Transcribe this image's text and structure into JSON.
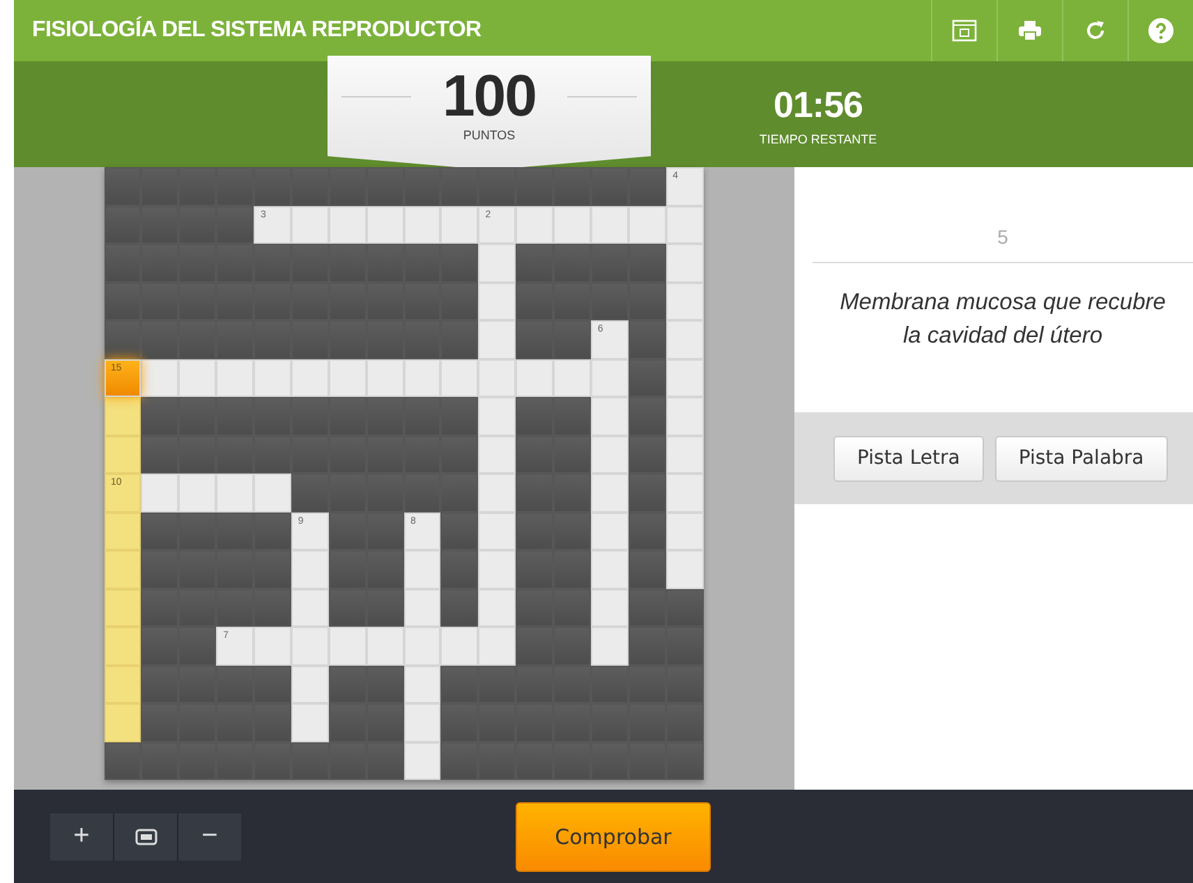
{
  "title": "FISIOLOGÍA DEL SISTEMA REPRODUCTOR",
  "toolbar": [
    {
      "kind": "fullscreen"
    },
    {
      "kind": "print"
    },
    {
      "kind": "restart"
    },
    {
      "kind": "help"
    }
  ],
  "score": {
    "value": "100",
    "label": "PUNTOS"
  },
  "timer": {
    "value": "01:56",
    "label": "TIEMPO RESTANTE"
  },
  "grid": [
    [
      {
        "kind": "block"
      },
      {
        "kind": "block"
      },
      {
        "kind": "block"
      },
      {
        "kind": "block"
      },
      {
        "kind": "block"
      },
      {
        "kind": "block"
      },
      {
        "kind": "block"
      },
      {
        "kind": "block"
      },
      {
        "kind": "block"
      },
      {
        "kind": "block"
      },
      {
        "kind": "block"
      },
      {
        "kind": "block"
      },
      {
        "kind": "block"
      },
      {
        "kind": "block"
      },
      {
        "kind": "block"
      },
      {
        "kind": "open",
        "number": "4"
      }
    ],
    [
      {
        "kind": "block"
      },
      {
        "kind": "block"
      },
      {
        "kind": "block"
      },
      {
        "kind": "block"
      },
      {
        "kind": "open",
        "number": "3"
      },
      {
        "kind": "open"
      },
      {
        "kind": "open"
      },
      {
        "kind": "open"
      },
      {
        "kind": "open"
      },
      {
        "kind": "open"
      },
      {
        "kind": "open",
        "number": "2"
      },
      {
        "kind": "open"
      },
      {
        "kind": "open"
      },
      {
        "kind": "open"
      },
      {
        "kind": "open"
      },
      {
        "kind": "open"
      }
    ],
    [
      {
        "kind": "block"
      },
      {
        "kind": "block"
      },
      {
        "kind": "block"
      },
      {
        "kind": "block"
      },
      {
        "kind": "block"
      },
      {
        "kind": "block"
      },
      {
        "kind": "block"
      },
      {
        "kind": "block"
      },
      {
        "kind": "block"
      },
      {
        "kind": "block"
      },
      {
        "kind": "open"
      },
      {
        "kind": "block"
      },
      {
        "kind": "block"
      },
      {
        "kind": "block"
      },
      {
        "kind": "block"
      },
      {
        "kind": "open"
      }
    ],
    [
      {
        "kind": "block"
      },
      {
        "kind": "block"
      },
      {
        "kind": "block"
      },
      {
        "kind": "block"
      },
      {
        "kind": "block"
      },
      {
        "kind": "block"
      },
      {
        "kind": "block"
      },
      {
        "kind": "block"
      },
      {
        "kind": "block"
      },
      {
        "kind": "block"
      },
      {
        "kind": "open"
      },
      {
        "kind": "block"
      },
      {
        "kind": "block"
      },
      {
        "kind": "block"
      },
      {
        "kind": "block"
      },
      {
        "kind": "open"
      }
    ],
    [
      {
        "kind": "block"
      },
      {
        "kind": "block"
      },
      {
        "kind": "block"
      },
      {
        "kind": "block"
      },
      {
        "kind": "block"
      },
      {
        "kind": "block"
      },
      {
        "kind": "block"
      },
      {
        "kind": "block"
      },
      {
        "kind": "block"
      },
      {
        "kind": "block"
      },
      {
        "kind": "open"
      },
      {
        "kind": "block"
      },
      {
        "kind": "block"
      },
      {
        "kind": "open",
        "number": "6"
      },
      {
        "kind": "block"
      },
      {
        "kind": "open"
      }
    ],
    [
      {
        "kind": "active",
        "number": "15"
      },
      {
        "kind": "open"
      },
      {
        "kind": "open"
      },
      {
        "kind": "open"
      },
      {
        "kind": "open"
      },
      {
        "kind": "open"
      },
      {
        "kind": "open"
      },
      {
        "kind": "open"
      },
      {
        "kind": "open"
      },
      {
        "kind": "open"
      },
      {
        "kind": "open"
      },
      {
        "kind": "open"
      },
      {
        "kind": "open"
      },
      {
        "kind": "open"
      },
      {
        "kind": "block"
      },
      {
        "kind": "open"
      }
    ],
    [
      {
        "kind": "word"
      },
      {
        "kind": "block"
      },
      {
        "kind": "block"
      },
      {
        "kind": "block"
      },
      {
        "kind": "block"
      },
      {
        "kind": "block"
      },
      {
        "kind": "block"
      },
      {
        "kind": "block"
      },
      {
        "kind": "block"
      },
      {
        "kind": "block"
      },
      {
        "kind": "open"
      },
      {
        "kind": "block"
      },
      {
        "kind": "block"
      },
      {
        "kind": "open"
      },
      {
        "kind": "block"
      },
      {
        "kind": "open"
      }
    ],
    [
      {
        "kind": "word"
      },
      {
        "kind": "block"
      },
      {
        "kind": "block"
      },
      {
        "kind": "block"
      },
      {
        "kind": "block"
      },
      {
        "kind": "block"
      },
      {
        "kind": "block"
      },
      {
        "kind": "block"
      },
      {
        "kind": "block"
      },
      {
        "kind": "block"
      },
      {
        "kind": "open"
      },
      {
        "kind": "block"
      },
      {
        "kind": "block"
      },
      {
        "kind": "open"
      },
      {
        "kind": "block"
      },
      {
        "kind": "open"
      }
    ],
    [
      {
        "kind": "word",
        "number": "10"
      },
      {
        "kind": "open"
      },
      {
        "kind": "open"
      },
      {
        "kind": "open"
      },
      {
        "kind": "open"
      },
      {
        "kind": "block"
      },
      {
        "kind": "block"
      },
      {
        "kind": "block"
      },
      {
        "kind": "block"
      },
      {
        "kind": "block"
      },
      {
        "kind": "open"
      },
      {
        "kind": "block"
      },
      {
        "kind": "block"
      },
      {
        "kind": "open"
      },
      {
        "kind": "block"
      },
      {
        "kind": "open"
      }
    ],
    [
      {
        "kind": "word"
      },
      {
        "kind": "block"
      },
      {
        "kind": "block"
      },
      {
        "kind": "block"
      },
      {
        "kind": "block"
      },
      {
        "kind": "open",
        "number": "9"
      },
      {
        "kind": "block"
      },
      {
        "kind": "block"
      },
      {
        "kind": "open",
        "number": "8"
      },
      {
        "kind": "block"
      },
      {
        "kind": "open"
      },
      {
        "kind": "block"
      },
      {
        "kind": "block"
      },
      {
        "kind": "open"
      },
      {
        "kind": "block"
      },
      {
        "kind": "open"
      }
    ],
    [
      {
        "kind": "word"
      },
      {
        "kind": "block"
      },
      {
        "kind": "block"
      },
      {
        "kind": "block"
      },
      {
        "kind": "block"
      },
      {
        "kind": "open"
      },
      {
        "kind": "block"
      },
      {
        "kind": "block"
      },
      {
        "kind": "open"
      },
      {
        "kind": "block"
      },
      {
        "kind": "open"
      },
      {
        "kind": "block"
      },
      {
        "kind": "block"
      },
      {
        "kind": "open"
      },
      {
        "kind": "block"
      },
      {
        "kind": "open"
      }
    ],
    [
      {
        "kind": "word"
      },
      {
        "kind": "block"
      },
      {
        "kind": "block"
      },
      {
        "kind": "block"
      },
      {
        "kind": "block"
      },
      {
        "kind": "open"
      },
      {
        "kind": "block"
      },
      {
        "kind": "block"
      },
      {
        "kind": "open"
      },
      {
        "kind": "block"
      },
      {
        "kind": "open"
      },
      {
        "kind": "block"
      },
      {
        "kind": "block"
      },
      {
        "kind": "open"
      },
      {
        "kind": "block"
      },
      {
        "kind": "block"
      }
    ],
    [
      {
        "kind": "word"
      },
      {
        "kind": "block"
      },
      {
        "kind": "block"
      },
      {
        "kind": "open",
        "number": "7"
      },
      {
        "kind": "open"
      },
      {
        "kind": "open"
      },
      {
        "kind": "open"
      },
      {
        "kind": "open"
      },
      {
        "kind": "open"
      },
      {
        "kind": "open"
      },
      {
        "kind": "open"
      },
      {
        "kind": "block"
      },
      {
        "kind": "block"
      },
      {
        "kind": "open"
      },
      {
        "kind": "block"
      },
      {
        "kind": "block"
      }
    ],
    [
      {
        "kind": "word"
      },
      {
        "kind": "block"
      },
      {
        "kind": "block"
      },
      {
        "kind": "block"
      },
      {
        "kind": "block"
      },
      {
        "kind": "open"
      },
      {
        "kind": "block"
      },
      {
        "kind": "block"
      },
      {
        "kind": "open"
      },
      {
        "kind": "block"
      },
      {
        "kind": "block"
      },
      {
        "kind": "block"
      },
      {
        "kind": "block"
      },
      {
        "kind": "block"
      },
      {
        "kind": "block"
      },
      {
        "kind": "block"
      }
    ],
    [
      {
        "kind": "word"
      },
      {
        "kind": "block"
      },
      {
        "kind": "block"
      },
      {
        "kind": "block"
      },
      {
        "kind": "block"
      },
      {
        "kind": "open"
      },
      {
        "kind": "block"
      },
      {
        "kind": "block"
      },
      {
        "kind": "open"
      },
      {
        "kind": "block"
      },
      {
        "kind": "block"
      },
      {
        "kind": "block"
      },
      {
        "kind": "block"
      },
      {
        "kind": "block"
      },
      {
        "kind": "block"
      },
      {
        "kind": "block"
      }
    ],
    [
      {
        "kind": "block"
      },
      {
        "kind": "block"
      },
      {
        "kind": "block"
      },
      {
        "kind": "block"
      },
      {
        "kind": "block"
      },
      {
        "kind": "block"
      },
      {
        "kind": "block"
      },
      {
        "kind": "block"
      },
      {
        "kind": "open"
      },
      {
        "kind": "block"
      },
      {
        "kind": "block"
      },
      {
        "kind": "block"
      },
      {
        "kind": "block"
      },
      {
        "kind": "block"
      },
      {
        "kind": "block"
      },
      {
        "kind": "block"
      }
    ]
  ],
  "clue": {
    "number": "5",
    "text": "Membrana mucosa que recubre la cavidad del útero"
  },
  "hint_buttons": [
    "Pista Letra",
    "Pista Palabra"
  ],
  "zoom_controls": [
    {
      "kind": "zoom-in",
      "label": "+"
    },
    {
      "kind": "fit"
    },
    {
      "kind": "zoom-out",
      "label": "−"
    }
  ],
  "check_button": "Comprobar"
}
